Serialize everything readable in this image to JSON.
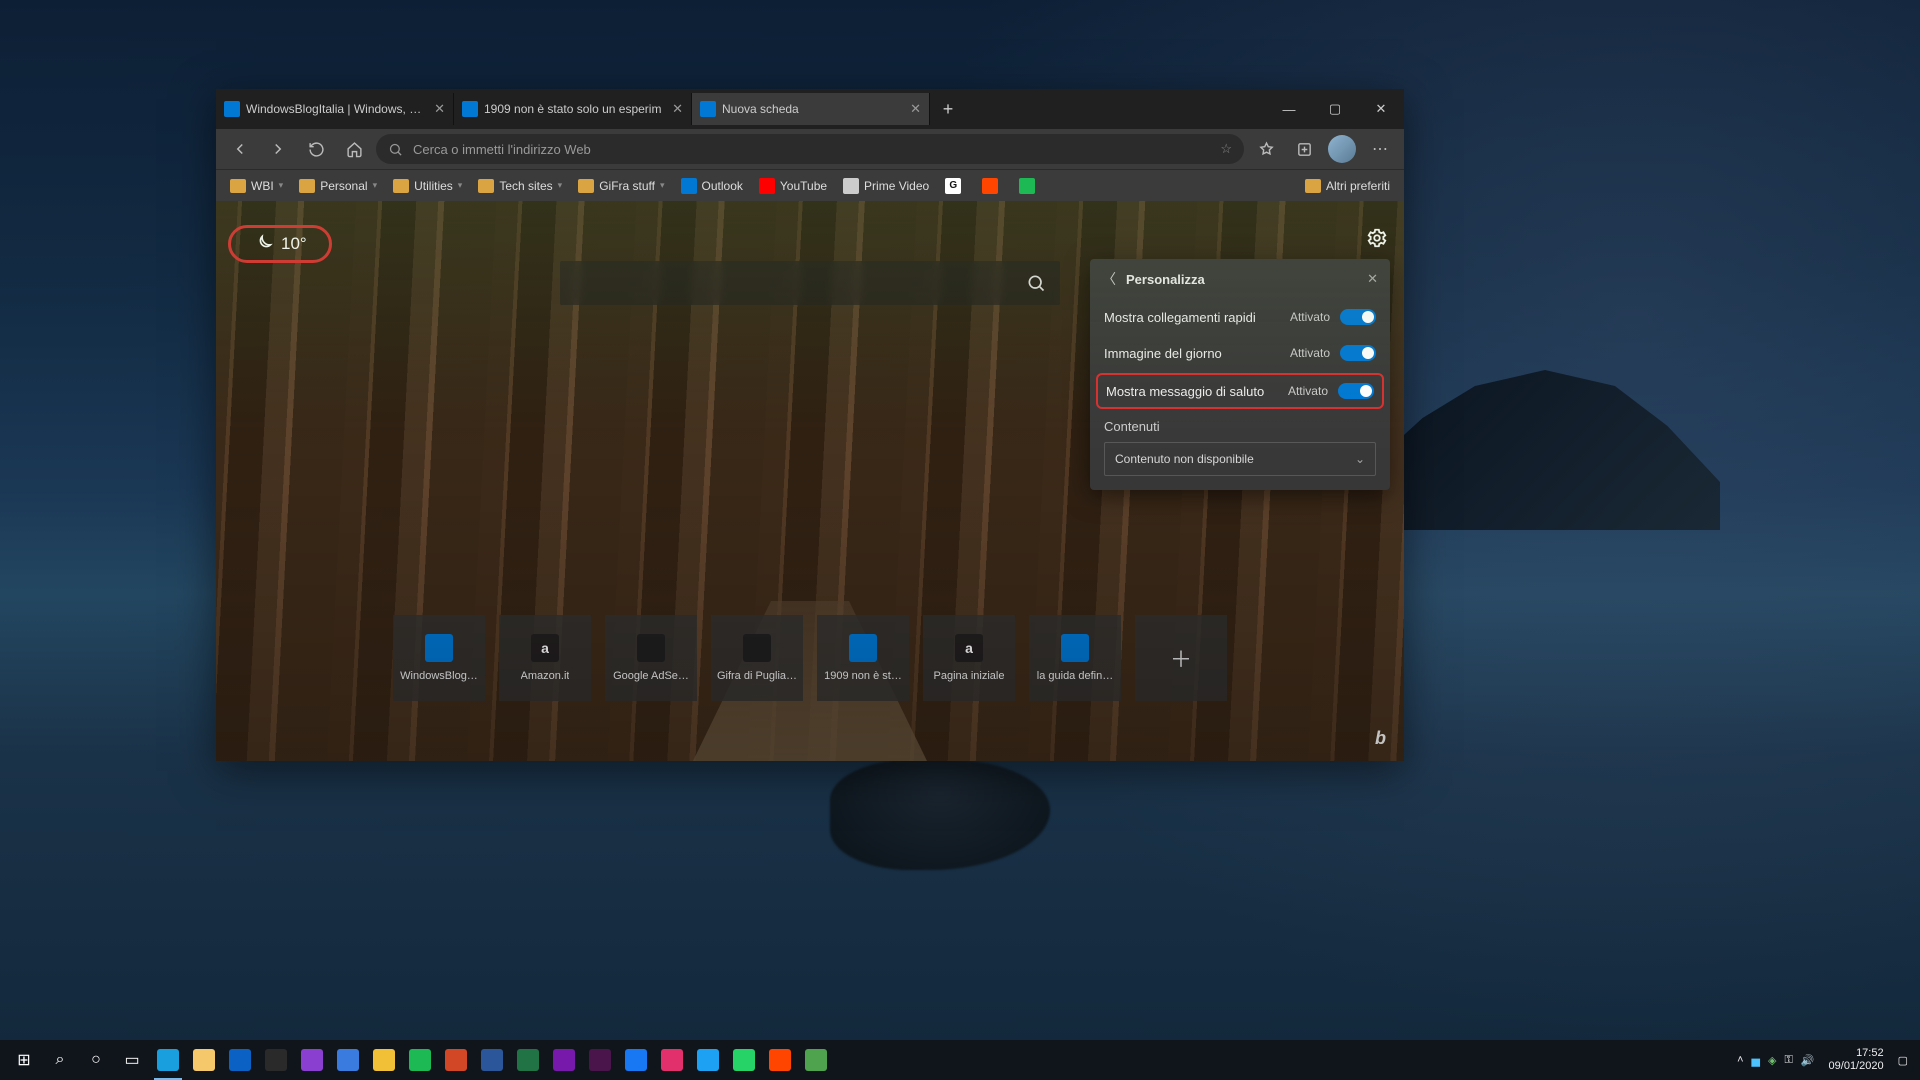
{
  "window_controls": {
    "min": "—",
    "max": "▢",
    "close": "✕"
  },
  "tabs": [
    {
      "title": "WindowsBlogItalia | Windows, S…",
      "active": false
    },
    {
      "title": "1909 non è stato solo un esperim",
      "active": false
    },
    {
      "title": "Nuova scheda",
      "active": true
    }
  ],
  "toolbar": {
    "address_placeholder": "Cerca o immetti l'indirizzo Web"
  },
  "bookmarks_bar": {
    "items": [
      {
        "label": "WBI",
        "type": "folder"
      },
      {
        "label": "Personal",
        "type": "folder"
      },
      {
        "label": "Utilities",
        "type": "folder"
      },
      {
        "label": "Tech sites",
        "type": "folder"
      },
      {
        "label": "GiFra stuff",
        "type": "folder"
      },
      {
        "label": "Outlook",
        "type": "link",
        "color": "#0078d4"
      },
      {
        "label": "YouTube",
        "type": "link",
        "color": "#ff0000"
      },
      {
        "label": "Prime Video",
        "type": "link",
        "color": "#cccccc"
      },
      {
        "label": "",
        "type": "link",
        "color": "#ffffff",
        "icon": "G"
      },
      {
        "label": "",
        "type": "link",
        "color": "#ff4500"
      },
      {
        "label": "",
        "type": "link",
        "color": "#1db954"
      }
    ],
    "overflow": "Altri preferiti"
  },
  "ntp": {
    "weather_temp": "10°",
    "quick_links": [
      {
        "label": "WindowsBlog…",
        "bg": "#0078d4",
        "txt": ""
      },
      {
        "label": "Amazon.it",
        "bg": "#231f20",
        "txt": "a"
      },
      {
        "label": "Google AdSe…",
        "bg": "#202020",
        "txt": ""
      },
      {
        "label": "Gifra di Puglia…",
        "bg": "#202020",
        "txt": ""
      },
      {
        "label": "1909 non è st…",
        "bg": "#0078d4",
        "txt": ""
      },
      {
        "label": "Pagina iniziale",
        "bg": "#231f20",
        "txt": "a"
      },
      {
        "label": "la guida defin…",
        "bg": "#0078d4",
        "txt": ""
      }
    ],
    "customize": {
      "title": "Personalizza",
      "rows": [
        {
          "label": "Mostra collegamenti rapidi",
          "state": "Attivato",
          "highlight": false
        },
        {
          "label": "Immagine del giorno",
          "state": "Attivato",
          "highlight": false
        },
        {
          "label": "Mostra messaggio di saluto",
          "state": "Attivato",
          "highlight": true
        }
      ],
      "section": "Contenuti",
      "select": "Contenuto non disponibile"
    }
  },
  "taskbar": {
    "apps": [
      {
        "name": "start",
        "bg": ""
      },
      {
        "name": "search",
        "bg": ""
      },
      {
        "name": "cortana",
        "bg": ""
      },
      {
        "name": "taskview",
        "bg": ""
      },
      {
        "name": "edge",
        "bg": "#1a9fde",
        "active": true
      },
      {
        "name": "explorer",
        "bg": "#f5c86b"
      },
      {
        "name": "yourphone",
        "bg": "#0b61c4"
      },
      {
        "name": "store",
        "bg": "#2a2a2a"
      },
      {
        "name": "paint3d",
        "bg": "#8a3fd1"
      },
      {
        "name": "todo",
        "bg": "#3a7be0"
      },
      {
        "name": "sticky",
        "bg": "#f2c037"
      },
      {
        "name": "spotify",
        "bg": "#1db954"
      },
      {
        "name": "powerpoint",
        "bg": "#d24726"
      },
      {
        "name": "word",
        "bg": "#2b579a"
      },
      {
        "name": "excel",
        "bg": "#217346"
      },
      {
        "name": "onenote",
        "bg": "#7719aa"
      },
      {
        "name": "slack",
        "bg": "#4a154b"
      },
      {
        "name": "facebook",
        "bg": "#1877f2"
      },
      {
        "name": "instagram",
        "bg": "#e1306c"
      },
      {
        "name": "twitter",
        "bg": "#1da1f2"
      },
      {
        "name": "whatsapp",
        "bg": "#25d366"
      },
      {
        "name": "reddit",
        "bg": "#ff4500"
      },
      {
        "name": "edgedev",
        "bg": "#4fa34f"
      }
    ],
    "time": "17:52",
    "date": "09/01/2020"
  }
}
